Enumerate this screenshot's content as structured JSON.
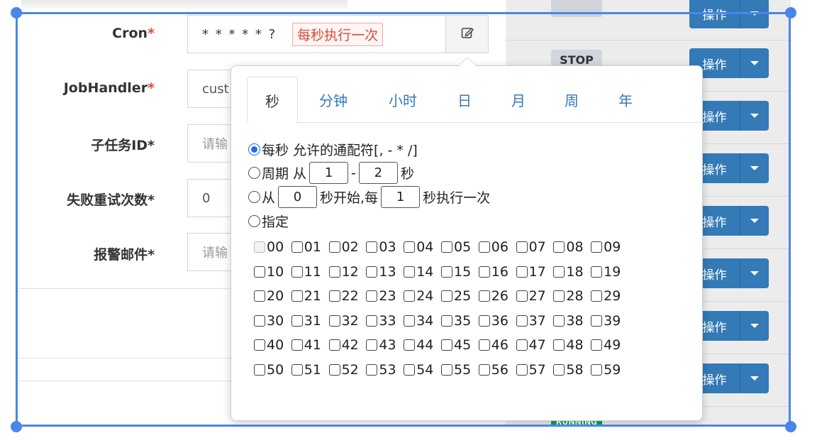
{
  "form": {
    "cron_label": "Cron",
    "jobhandler_label": "JobHandler",
    "subtask_label": "子任务ID*",
    "retry_label": "失败重试次数*",
    "alarm_label": "报警邮件*",
    "required_mark": "*",
    "cron_value": "* * * * * ?",
    "cron_desc": "每秒执行一次",
    "jobhandler_value": "cust",
    "subtask_placeholder": "请输",
    "retry_value": "0",
    "alarm_placeholder": "请输"
  },
  "table": {
    "op_label": "操作",
    "status_stop": "STOP",
    "status_running": "RUNNING",
    "op_buttons": [
      1,
      2,
      3,
      4,
      5,
      6,
      7,
      8
    ]
  },
  "popover": {
    "tabs": [
      "秒",
      "分钟",
      "小时",
      "日",
      "月",
      "周",
      "年"
    ],
    "active_tab": "秒",
    "option_every": "每秒 允许的通配符[, - * /]",
    "option_cycle_prefix": "周期 从",
    "cycle_from": "1",
    "cycle_dash": "-",
    "cycle_to": "2",
    "cycle_unit": "秒",
    "option_from_prefix": "从",
    "from_start": "0",
    "from_mid": "秒开始,每",
    "from_every": "1",
    "from_suffix": "秒执行一次",
    "option_specify": "指定",
    "seconds": [
      "00",
      "01",
      "02",
      "03",
      "04",
      "05",
      "06",
      "07",
      "08",
      "09",
      "10",
      "11",
      "12",
      "13",
      "14",
      "15",
      "16",
      "17",
      "18",
      "19",
      "20",
      "21",
      "22",
      "23",
      "24",
      "25",
      "26",
      "27",
      "28",
      "29",
      "30",
      "31",
      "32",
      "33",
      "34",
      "35",
      "36",
      "37",
      "38",
      "39",
      "40",
      "41",
      "42",
      "43",
      "44",
      "45",
      "46",
      "47",
      "48",
      "49",
      "50",
      "51",
      "52",
      "53",
      "54",
      "55",
      "56",
      "57",
      "58",
      "59"
    ]
  },
  "colors": {
    "accent": "#337ab7",
    "required": "#dd4b39",
    "selection": "#4a86e8"
  }
}
